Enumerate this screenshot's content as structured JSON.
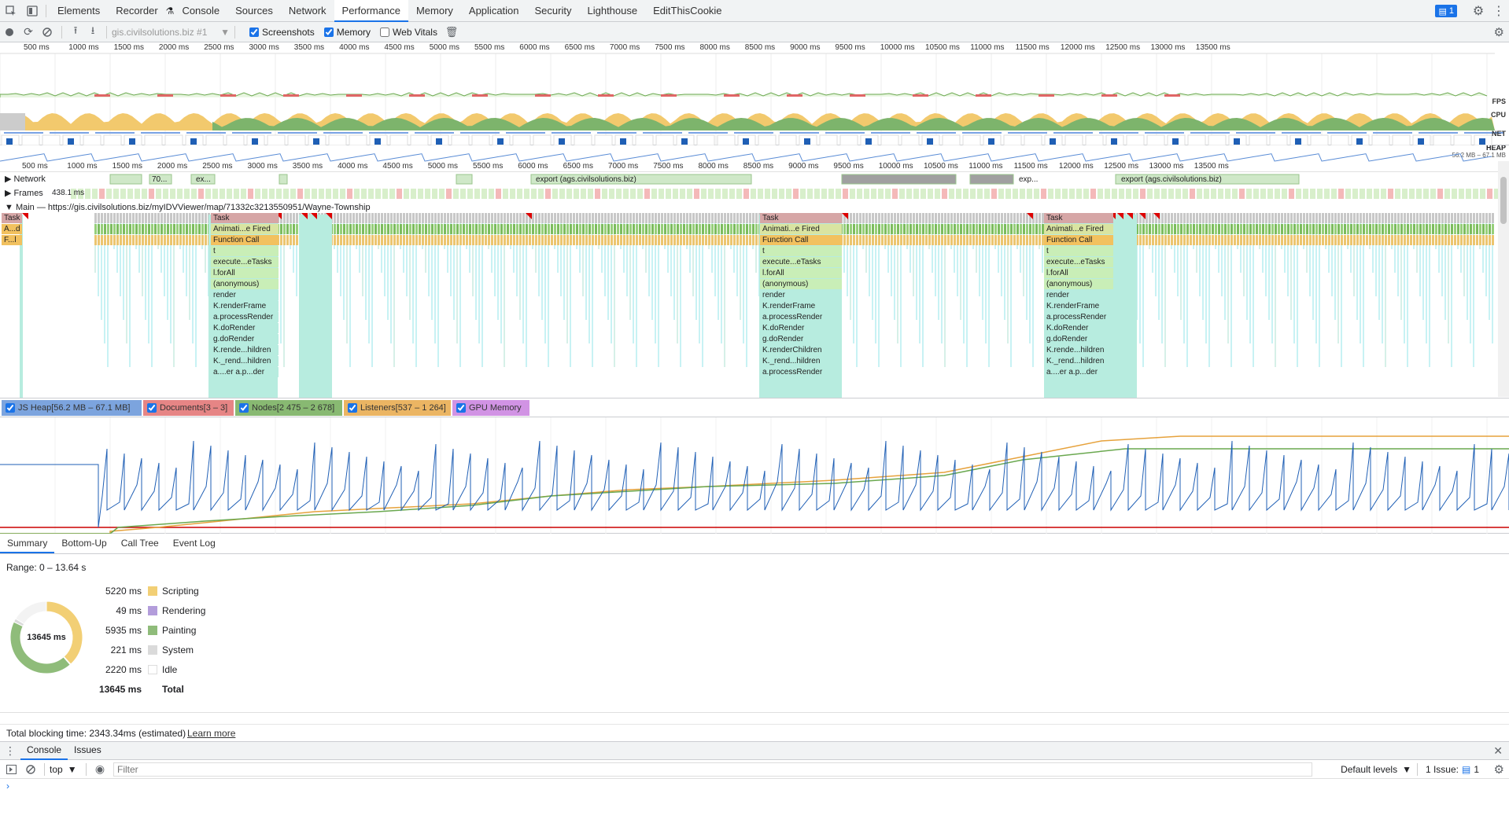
{
  "tabs": [
    "Elements",
    "Recorder",
    "Console",
    "Sources",
    "Network",
    "Performance",
    "Memory",
    "Application",
    "Security",
    "Lighthouse",
    "EditThisCookie"
  ],
  "active_tab": "Performance",
  "issues_badge": "1",
  "toolbar": {
    "profile_select": "gis.civilsolutions.biz #1",
    "screenshots_label": "Screenshots",
    "memory_label": "Memory",
    "webvitals_label": "Web Vitals"
  },
  "overview_ticks": [
    "500 ms",
    "1000 ms",
    "1500 ms",
    "2000 ms",
    "2500 ms",
    "3000 ms",
    "3500 ms",
    "4000 ms",
    "4500 ms",
    "5000 ms",
    "5500 ms",
    "6000 ms",
    "6500 ms",
    "7000 ms",
    "7500 ms",
    "8000 ms",
    "8500 ms",
    "9000 ms",
    "9500 ms",
    "10000 ms",
    "10500 ms",
    "11000 ms",
    "11500 ms",
    "12000 ms",
    "12500 ms",
    "13000 ms",
    "13500 ms"
  ],
  "overview_labels": {
    "fps": "FPS",
    "cpu": "CPU",
    "net": "NET",
    "heap": "HEAP",
    "heap_range": "56.2 MB – 67.1 MB"
  },
  "tracks": {
    "network": "Network",
    "frames": "Frames",
    "frames_value": "438.1 ms",
    "main": "Main — https://gis.civilsolutions.biz/myIDVViewer/map/71332c3213550951/Wayne-Township",
    "net_items": [
      "70...",
      "ex...",
      "export (ags.civilsolutions.biz)",
      "exp...",
      "export (ags.civilsolutions.biz)"
    ]
  },
  "flame_stack": [
    "Task",
    "Animati...e Fired",
    "Function Call",
    "t",
    "execute...eTasks",
    "l.forAll",
    "(anonymous)",
    "render",
    "K.renderFrame",
    "a.processRender",
    "K.doRender",
    "g.doRender",
    "K.rende...hildren",
    "K._rend...hildren",
    "a....er  a.p...der"
  ],
  "flame_stack_b": [
    "Task",
    "Animati...e Fired",
    "Function Call",
    "t",
    "execute...eTasks",
    "l.forAll",
    "(anonymous)",
    "render",
    "K.renderFrame",
    "a.processRender",
    "K.doRender",
    "g.doRender",
    "K.renderChildren",
    "K._rend...hildren",
    "a.processRender"
  ],
  "flame_left": [
    "Task",
    "A...d",
    "F...l"
  ],
  "memory_chips": [
    {
      "label": "JS Heap[56.2 MB – 67.1 MB]",
      "color": "#5b8dd6"
    },
    {
      "label": "Documents[3 – 3]",
      "color": "#e06666"
    },
    {
      "label": "Nodes[2 475 – 2 678]",
      "color": "#6aa84f"
    },
    {
      "label": "Listeners[537 – 1 264]",
      "color": "#e6a23c"
    },
    {
      "label": "GPU Memory",
      "color": "#c678dd"
    }
  ],
  "bottom_tabs": [
    "Summary",
    "Bottom-Up",
    "Call Tree",
    "Event Log"
  ],
  "summary": {
    "range": "Range: 0 – 13.64 s",
    "total_center": "13645 ms",
    "items": [
      {
        "ms": "5220 ms",
        "label": "Scripting",
        "color": "#f2cf75"
      },
      {
        "ms": "49 ms",
        "label": "Rendering",
        "color": "#b39ddb"
      },
      {
        "ms": "5935 ms",
        "label": "Painting",
        "color": "#8fbc7a"
      },
      {
        "ms": "221 ms",
        "label": "System",
        "color": "#dadada"
      },
      {
        "ms": "2220 ms",
        "label": "Idle",
        "color": "#ffffff"
      }
    ],
    "total_ms": "13645 ms",
    "total_label": "Total",
    "blocking": "Total blocking time: 2343.34ms (estimated)",
    "learn_more": "Learn more"
  },
  "donut_values": [
    5220,
    49,
    5935,
    221,
    2220
  ],
  "console": {
    "tabs": [
      "Console",
      "Issues"
    ],
    "context": "top",
    "filter_placeholder": "Filter",
    "levels": "Default levels",
    "issues": "1 Issue:",
    "issues_count": "1"
  }
}
